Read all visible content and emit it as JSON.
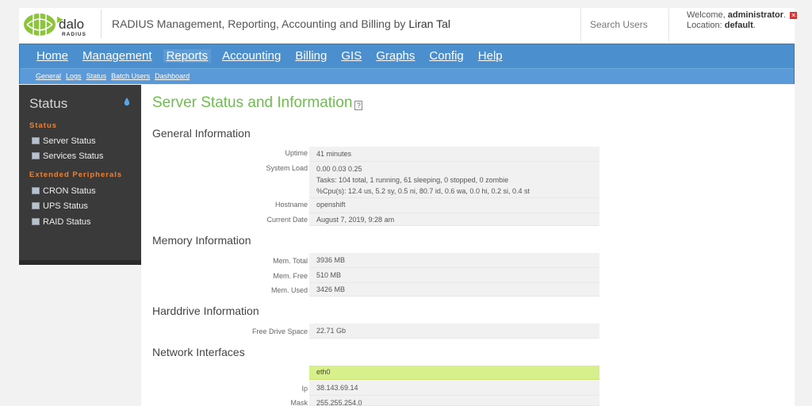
{
  "header": {
    "tagline_main": "RADIUS Management, Reporting, Accounting and Billing by",
    "tagline_author": "Liran Tal",
    "search_placeholder": "Search Users",
    "welcome_prefix": "Welcome,",
    "username": "administrator",
    "location_prefix": "Location:",
    "location": "default"
  },
  "nav": {
    "main": [
      "Home",
      "Management",
      "Reports",
      "Accounting",
      "Billing",
      "GIS",
      "Graphs",
      "Config",
      "Help"
    ],
    "active": "Reports",
    "sub": [
      "General",
      "Logs",
      "Status",
      "Batch Users",
      "Dashboard"
    ]
  },
  "sidebar": {
    "title": "Status",
    "section1": "Status",
    "items1": [
      "Server Status",
      "Services Status"
    ],
    "section2": "Extended Peripherals",
    "items2": [
      "CRON Status",
      "UPS Status",
      "RAID Status"
    ]
  },
  "main": {
    "title": "Server Status and Information",
    "general": {
      "title": "General Information",
      "uptime_label": "Uptime",
      "uptime": "41 minutes",
      "load_label": "System Load",
      "load": "0.00 0.03 0.25",
      "tasks": "Tasks: 104 total, 1 running, 61 sleeping, 0 stopped, 0 zombie",
      "cpu": "%Cpu(s): 12.4 us, 5.2 sy, 0.5 ni, 80.7 id, 0.6 wa, 0.0 hi, 0.2 si, 0.4 st",
      "hostname_label": "Hostname",
      "hostname": "openshift",
      "date_label": "Current Date",
      "date": "August 7, 2019, 9:28 am"
    },
    "memory": {
      "title": "Memory Information",
      "total_label": "Mem. Total",
      "total": "3936 MB",
      "free_label": "Mem. Free",
      "free": "510 MB",
      "used_label": "Mem. Used",
      "used": "3426 MB"
    },
    "hdd": {
      "title": "Harddrive Information",
      "free_label": "Free Drive Space",
      "free": "22.71 Gb"
    },
    "network": {
      "title": "Network Interfaces",
      "iface": "eth0",
      "ip_label": "Ip",
      "ip": "38.143.69.14",
      "mask_label": "Mask",
      "mask": "255.255.254.0"
    }
  }
}
